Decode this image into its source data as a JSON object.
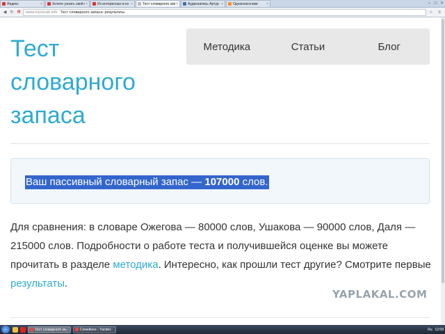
{
  "browser": {
    "tabs": [
      {
        "label": "Яндекс",
        "active": false,
        "favicon_color": "#d23"
      },
      {
        "label": "Хотите узнать свой с",
        "active": false,
        "favicon_color": "#c22"
      },
      {
        "label": "Из интересных в ко",
        "active": false,
        "favicon_color": "#c22"
      },
      {
        "label": "Тест словарного запа",
        "active": true,
        "favicon_color": "#aaa"
      },
      {
        "label": "Аудиозапись Артур",
        "active": false,
        "favicon_color": "#4a6fa5"
      },
      {
        "label": "Одноклассники",
        "active": false,
        "favicon_color": "#f7931e"
      }
    ],
    "address": {
      "host": "www.myvocab.info",
      "page_title": "Тест словарного запаса: результаты"
    }
  },
  "site": {
    "title": "Тест словарного запаса",
    "menu": [
      "Методика",
      "Статьи",
      "Блог"
    ]
  },
  "result": {
    "prefix": "Ваш пассивный словарный запас — ",
    "value": "107000",
    "suffix": " слов."
  },
  "paragraph": {
    "text1": "Для сравнения: в словаре Ожегова — 80000 слов, Ушакова — 90000 слов, Даля — 215000 слов. Подробности о работе теста и получившейся оценке вы можете прочитать в разделе ",
    "link1": "методика",
    "text2": ". Интересно, как прошли тест другие? Смотрите первые ",
    "link2": "результаты",
    "text3": "."
  },
  "watermark": "YAPLAKAL.COM",
  "taskbar": {
    "tasks": [
      {
        "label": "Тест словарного за...",
        "active": true
      },
      {
        "label": "Семейнее - Yandex",
        "active": false
      }
    ],
    "lang": "Ru",
    "clock": "12:09"
  },
  "colors": {
    "accent": "#2eaad2",
    "selection": "#3366cc",
    "menu_bg": "#e8e8e8",
    "result_bg": "#f2f7fb"
  }
}
